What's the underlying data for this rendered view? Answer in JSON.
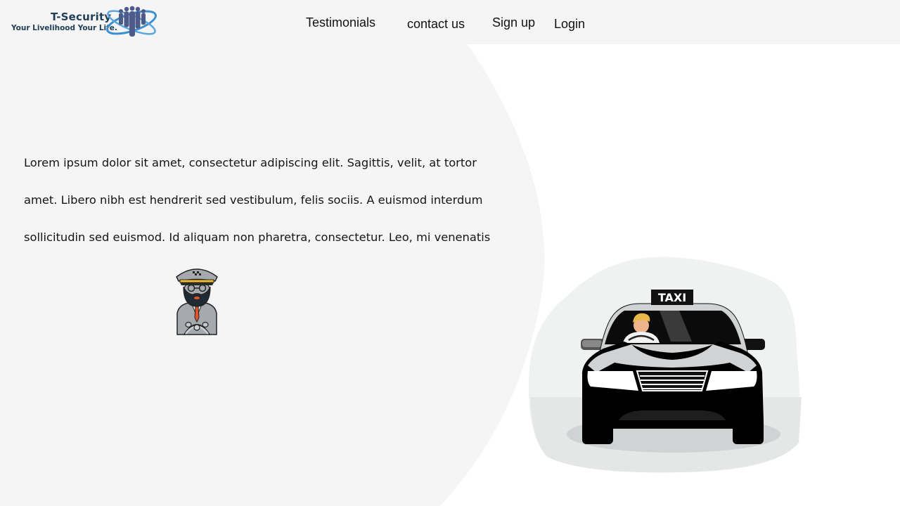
{
  "brand": {
    "name": "T-Security",
    "tagline": "Your Livelihood Your Life."
  },
  "nav": {
    "items": [
      {
        "label": "Testimonials"
      },
      {
        "label": "contact us"
      },
      {
        "label": "Sign up"
      },
      {
        "label": "Login"
      }
    ]
  },
  "hero": {
    "text": "Lorem ipsum dolor sit amet, consectetur adipiscing elit. Sagittis, velit, at tortor amet. Libero nibh est hendrerit sed vestibulum, felis sociis. A euismod interdum sollicitudin sed euismod. Id aliquam non pharetra, consectetur. Leo, mi venenatis"
  },
  "illustration": {
    "taxi_sign": "TAXI"
  },
  "colors": {
    "header_bg": "#f5f5f5",
    "panel_bg": "#f5f5f5",
    "brand_navy": "#1f3d57",
    "brand_blue": "#3d8fd1"
  },
  "icons": {
    "logo": "globe-people-logo",
    "driver": "taxi-driver-illustration",
    "taxi": "taxi-car-illustration"
  }
}
